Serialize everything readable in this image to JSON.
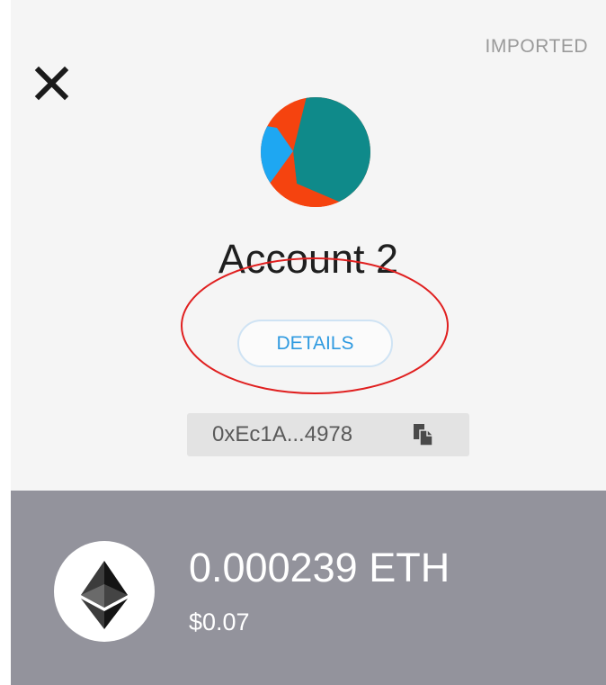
{
  "header": {
    "account_type_badge": "IMPORTED",
    "close_icon": "close-icon"
  },
  "account": {
    "name": "Account 2",
    "identicon": "jazzicon-avatar",
    "details_label": "DETAILS",
    "address_short": "0xEc1A...4978",
    "copy_icon": "copy-icon"
  },
  "balance": {
    "token_icon": "ethereum-logo-icon",
    "amount": "0.000239 ETH",
    "fiat": "$0.07"
  },
  "colors": {
    "panel_bg": "#f5f5f5",
    "balance_bg": "#93939c",
    "details_text": "#2f9ae0",
    "annotation_circle": "#e02020",
    "identicon_teal": "#0f8a8a",
    "identicon_orange": "#f5430f",
    "identicon_blue": "#1ea7f2"
  }
}
